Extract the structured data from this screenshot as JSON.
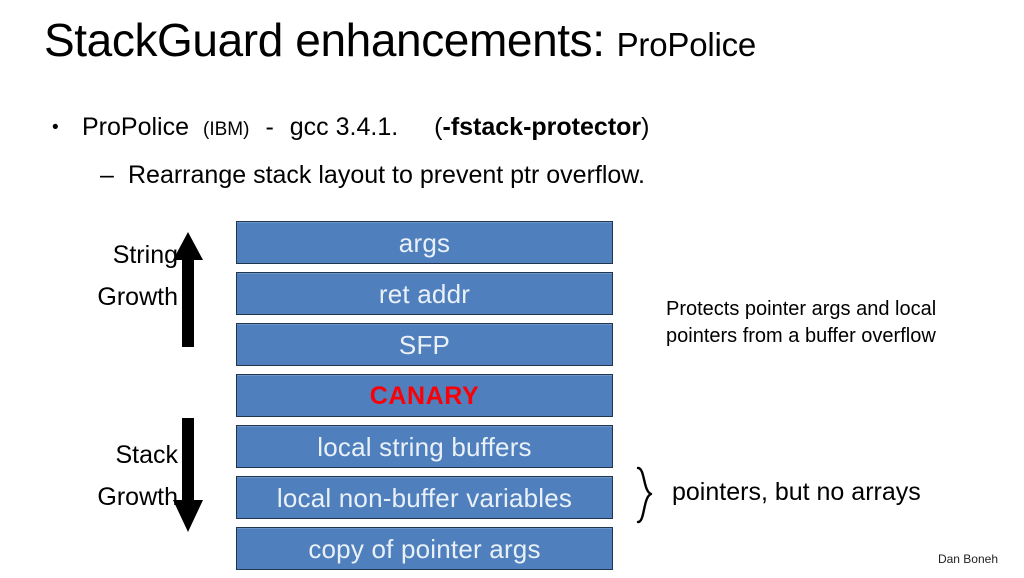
{
  "slide": {
    "title_main": "StackGuard enhancements:",
    "title_sub": "ProPolice"
  },
  "bullets": {
    "level1": {
      "marker": "•",
      "name": "ProPolice",
      "vendor": "(IBM)",
      "dash": "-",
      "compiler": "gcc 3.4.1.",
      "flag_open": "(",
      "flag": "-fstack-protector",
      "flag_close": ")"
    },
    "level2": {
      "marker": "–",
      "text": "Rearrange stack layout to prevent ptr overflow."
    }
  },
  "diagram": {
    "rows": [
      {
        "label": "args",
        "style": "normal"
      },
      {
        "label": "ret addr",
        "style": "normal"
      },
      {
        "label": "SFP",
        "style": "normal"
      },
      {
        "label": "CANARY",
        "style": "canary"
      },
      {
        "label": "local string buffers",
        "style": "normal"
      },
      {
        "label": "local non-buffer variables",
        "style": "normal"
      },
      {
        "label": "copy of pointer args",
        "style": "normal"
      }
    ],
    "box_fill": "#4F80BD",
    "box_border": "#21354D",
    "box_text_color": "#EAF0F8",
    "canary_text_color": "#FB0007",
    "string_growth": {
      "line1": "String",
      "line2": "Growth",
      "arrow": "arrow-up"
    },
    "stack_growth": {
      "line1": "Stack",
      "line2": "Growth",
      "arrow": "arrow-down"
    }
  },
  "notes": {
    "protects": {
      "line1": "Protects pointer args and local",
      "line2": "pointers from a buffer overflow"
    },
    "pointers": "pointers, but no arrays"
  },
  "footer": {
    "attribution": "Dan Boneh"
  }
}
